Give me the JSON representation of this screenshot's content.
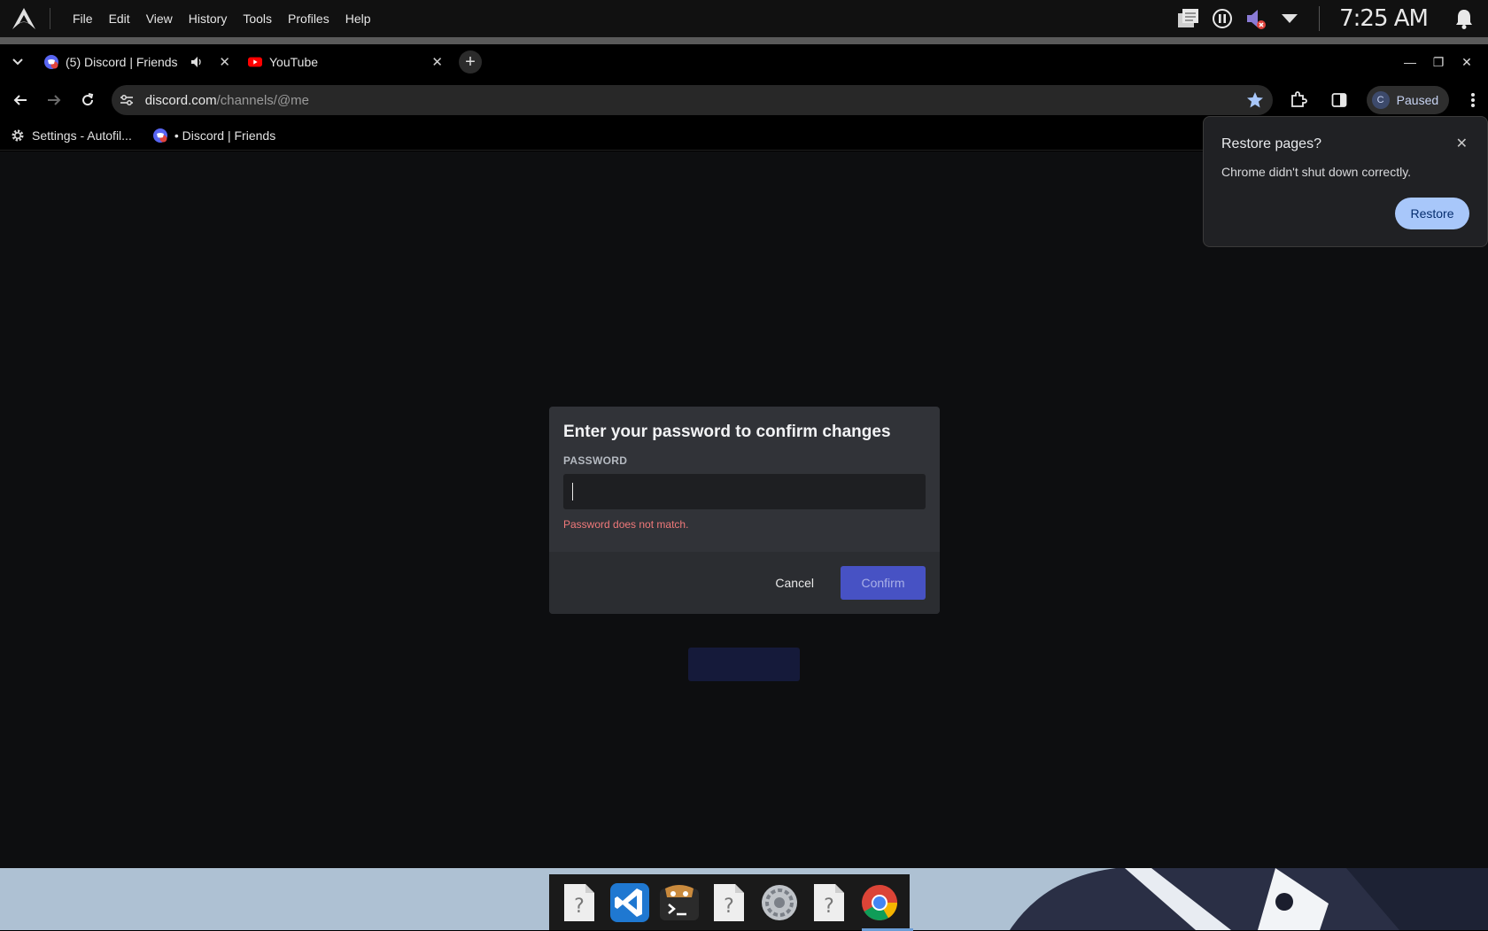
{
  "os": {
    "menu": [
      "File",
      "Edit",
      "View",
      "History",
      "Tools",
      "Profiles",
      "Help"
    ],
    "clock": "7:25 AM",
    "tray_icons": [
      "notes-icon",
      "pause-icon",
      "volume-muted-icon",
      "dropdown-icon"
    ]
  },
  "tabs": [
    {
      "title": "(5) Discord | Friends",
      "icon": "discord-icon",
      "audio": true
    },
    {
      "title": "YouTube",
      "icon": "youtube-icon",
      "audio": false
    }
  ],
  "address": {
    "host": "discord.com",
    "path": "/channels/@me"
  },
  "profile": {
    "initial": "C",
    "status": "Paused"
  },
  "bookmarks": [
    {
      "label": "Settings - Autofil...",
      "icon": "gear-icon"
    },
    {
      "label": "• Discord | Friends",
      "icon": "discord-icon"
    }
  ],
  "modal": {
    "title": "Enter your password to confirm changes",
    "field_label": "PASSWORD",
    "password_value": "",
    "error": "Password does not match.",
    "cancel_label": "Cancel",
    "confirm_label": "Confirm"
  },
  "restore_popup": {
    "title": "Restore pages?",
    "message": "Chrome didn't shut down correctly.",
    "button_label": "Restore"
  },
  "dock_icons": [
    "unknown-file-icon",
    "vscode-icon",
    "terminal-icon",
    "unknown-file-icon",
    "settings-icon",
    "unknown-file-icon",
    "chrome-icon"
  ],
  "colors": {
    "discord_modal_bg": "#313338",
    "confirm_button": "#4752c4",
    "error_text": "#f0797a",
    "restore_button": "#a8c7fa"
  }
}
